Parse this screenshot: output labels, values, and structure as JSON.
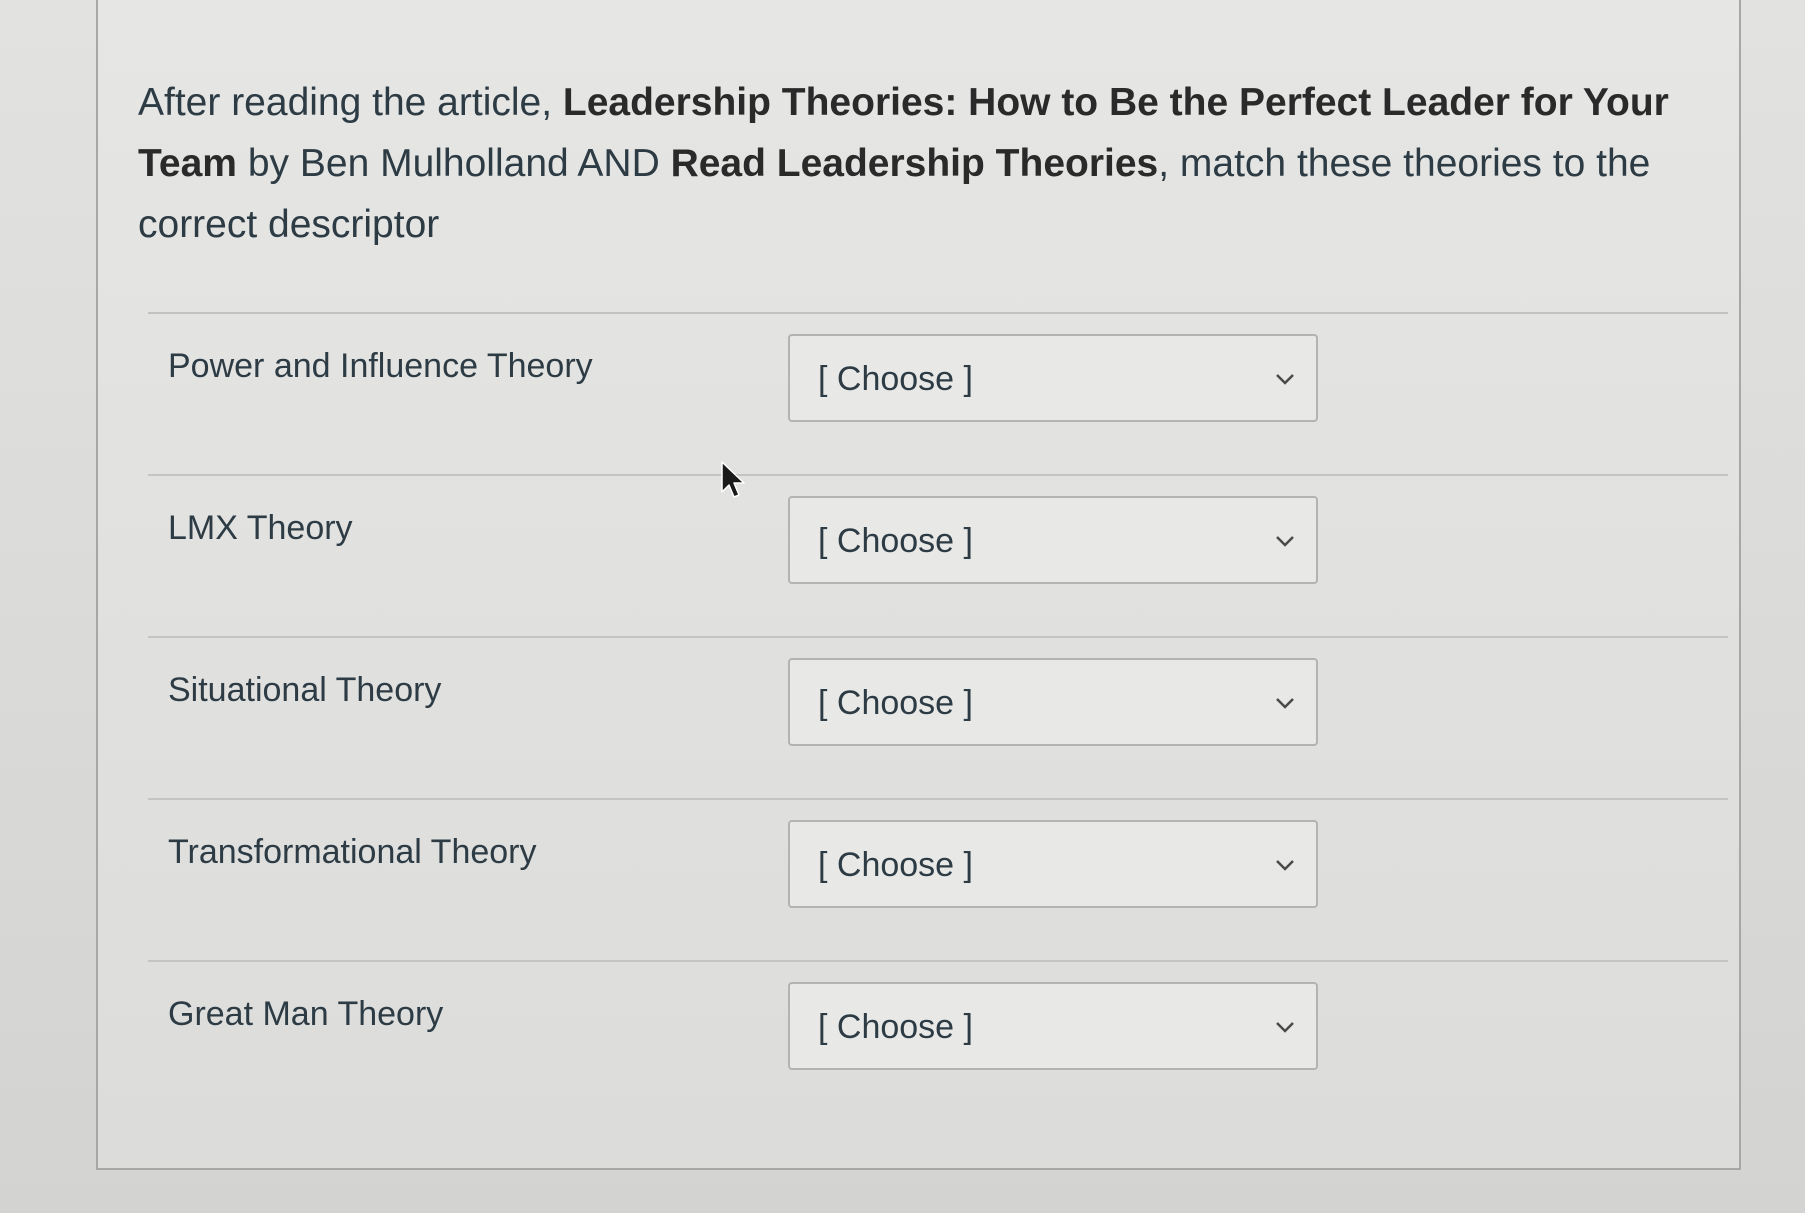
{
  "question": {
    "prefix": "After reading the article, ",
    "article_title": "Leadership Theories: How to Be the Perfect Leader for Your Team",
    "by_text": " by Ben Mulholland AND ",
    "read_title": "Read Leadership Theories",
    "suffix": ", match these theories to the correct descriptor"
  },
  "answers": [
    {
      "label": "Power and Influence Theory",
      "selected": "[ Choose ]"
    },
    {
      "label": "LMX Theory",
      "selected": "[ Choose ]"
    },
    {
      "label": "Situational Theory",
      "selected": "[ Choose ]"
    },
    {
      "label": "Transformational Theory",
      "selected": "[ Choose ]"
    },
    {
      "label": "Great Man Theory",
      "selected": "[ Choose ]"
    }
  ],
  "icons": {
    "dropdown": "chevron-down-icon",
    "cursor": "mouse-cursor-icon"
  },
  "colors": {
    "text": "#2d3b45",
    "border": "#b3b3b1",
    "background": "#dcdcda"
  }
}
